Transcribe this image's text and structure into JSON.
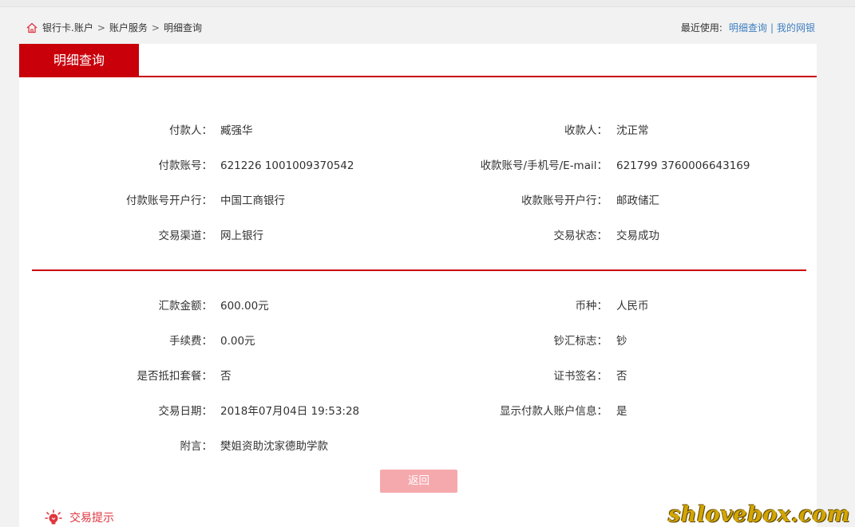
{
  "breadcrumb": [
    "银行卡.账户",
    "账户服务",
    "明细查询"
  ],
  "breadcrumb_sep": ">",
  "recent": {
    "label": "最近使用:",
    "links": [
      "明细查询",
      "我的网银"
    ],
    "separator": "|"
  },
  "tab": {
    "title": "明细查询"
  },
  "section1": {
    "left": [
      {
        "label": "付款人：",
        "value": "臧强华"
      },
      {
        "label": "付款账号：",
        "value": "621226 1001009370542"
      },
      {
        "label": "付款账号开户行：",
        "value": "中国工商银行"
      },
      {
        "label": "交易渠道：",
        "value": "网上银行"
      }
    ],
    "right": [
      {
        "label": "收款人：",
        "value": "沈正常"
      },
      {
        "label": "收款账号/手机号/E-mail：",
        "value": "621799 3760006643169"
      },
      {
        "label": "收款账号开户行：",
        "value": "邮政储汇"
      },
      {
        "label": "交易状态：",
        "value": "交易成功"
      }
    ]
  },
  "section2": {
    "left": [
      {
        "label": "汇款金额：",
        "value": "600.00元"
      },
      {
        "label": "手续费：",
        "value": "0.00元"
      },
      {
        "label": "是否抵扣套餐：",
        "value": "否"
      },
      {
        "label": "交易日期：",
        "value": "2018年07月04日 19:53:28"
      },
      {
        "label": "附言：",
        "value": "樊姐资助沈家德助学款"
      }
    ],
    "right": [
      {
        "label": "币种：",
        "value": "人民币"
      },
      {
        "label": "钞汇标志：",
        "value": "钞"
      },
      {
        "label": "证书签名：",
        "value": "否"
      },
      {
        "label": "显示付款人账户信息：",
        "value": "是"
      }
    ]
  },
  "buttons": {
    "back": "返回"
  },
  "tip": {
    "label": "交易提示"
  },
  "watermark": "shlovebox.com",
  "colors": {
    "accent": "#c9000a",
    "button": "#f6a9ad",
    "link": "#3d7fc1"
  }
}
